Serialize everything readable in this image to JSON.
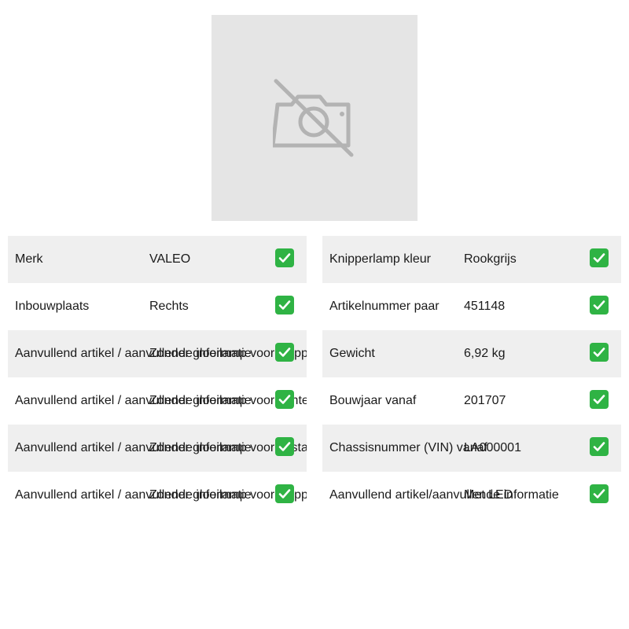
{
  "image": {
    "icon": "no-camera-icon"
  },
  "left_table": [
    {
      "label": "Merk",
      "value": "VALEO"
    },
    {
      "label": "Inbouwplaats",
      "value": "Rechts"
    },
    {
      "label": "Aanvullend artikel / aanvullende informatie",
      "value": "Zonder gloeilamp voor knipperlicht"
    },
    {
      "label": "Aanvullend artikel / aanvullende informatie",
      "value": "Zonder gloeilamp voor achteruitrijlicht"
    },
    {
      "label": "Aanvullend artikel / aanvullende informatie",
      "value": "Zonder gloeilamp voor mistachterlicht"
    },
    {
      "label": "Aanvullend artikel / aanvullende informatie",
      "value": "Zonder gloeilamp voor knipperlicht"
    }
  ],
  "right_table": [
    {
      "label": "Knipperlamp kleur",
      "value": "Rookgrijs"
    },
    {
      "label": "Artikelnummer paar",
      "value": "451148"
    },
    {
      "label": "Gewicht",
      "value": "6,92 kg"
    },
    {
      "label": "Bouwjaar vanaf",
      "value": "201707"
    },
    {
      "label": "Chassisnummer (VIN) vanaf",
      "value": "LA000001"
    },
    {
      "label": "Aanvullend artikel/aanvullende informatie",
      "value": "Met LED"
    }
  ],
  "check_icon": "check-mark-icon",
  "colors": {
    "shaded_row": "#efefef",
    "check_green": "#2fb344",
    "image_bg": "#e5e5e5"
  }
}
